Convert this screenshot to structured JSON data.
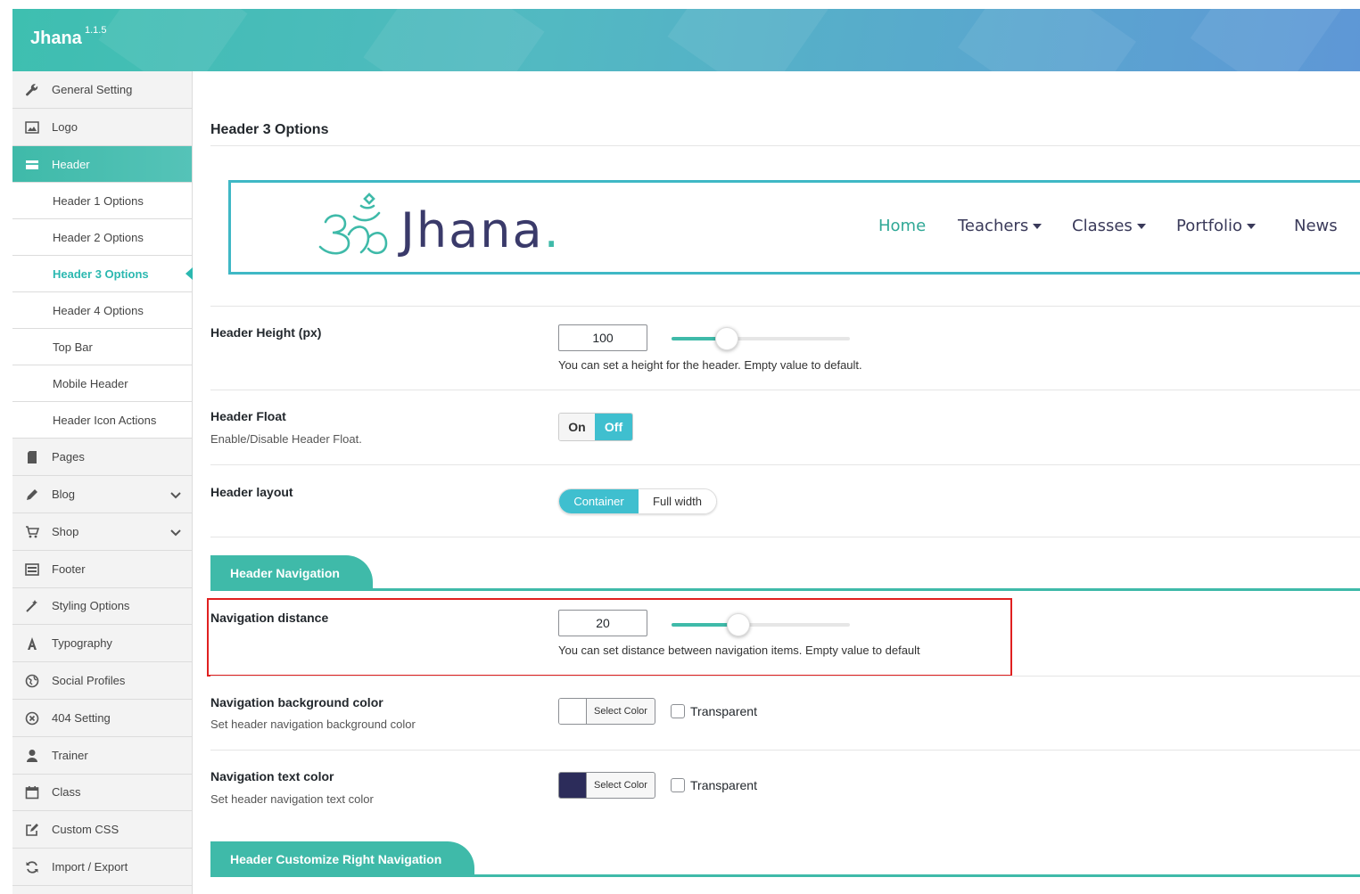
{
  "app": {
    "brand": "Jhana",
    "version": "1.1.5"
  },
  "colors": {
    "accent": "#3fbaa9",
    "toggle_active": "#3fbfcf",
    "highlight": "#e02020",
    "nav_text_color": "#2c2c5a"
  },
  "sidebar": {
    "items": [
      {
        "label": "General Setting",
        "icon": "wrench-icon"
      },
      {
        "label": "Logo",
        "icon": "image-icon"
      },
      {
        "label": "Header",
        "icon": "card-icon"
      },
      {
        "label": "Header 1 Options"
      },
      {
        "label": "Header 2 Options"
      },
      {
        "label": "Header 3 Options"
      },
      {
        "label": "Header 4 Options"
      },
      {
        "label": "Top Bar"
      },
      {
        "label": "Mobile Header"
      },
      {
        "label": "Header Icon Actions"
      },
      {
        "label": "Pages",
        "icon": "pages-icon"
      },
      {
        "label": "Blog",
        "icon": "pencil-icon"
      },
      {
        "label": "Shop",
        "icon": "cart-icon"
      },
      {
        "label": "Footer",
        "icon": "footer-icon"
      },
      {
        "label": "Styling Options",
        "icon": "wand-icon"
      },
      {
        "label": "Typography",
        "icon": "typography-icon"
      },
      {
        "label": "Social Profiles",
        "icon": "globe-icon"
      },
      {
        "label": "404 Setting",
        "icon": "circle-x-icon"
      },
      {
        "label": "Trainer",
        "icon": "user-icon"
      },
      {
        "label": "Class",
        "icon": "calendar-icon"
      },
      {
        "label": "Custom CSS",
        "icon": "edit-icon"
      },
      {
        "label": "Import / Export",
        "icon": "refresh-icon"
      }
    ]
  },
  "main": {
    "title": "Header 3 Options",
    "preview": {
      "logo_text": "Jhana",
      "logo_dot": ".",
      "nav": [
        "Home",
        "Teachers",
        "Classes",
        "Portfolio",
        "News"
      ]
    },
    "header_height": {
      "label": "Header Height (px)",
      "value": "100",
      "slider_fraction": 0.31,
      "help": "You can set a height for the header. Empty value to default."
    },
    "header_float": {
      "label": "Header Float",
      "desc": "Enable/Disable Header Float.",
      "on": "On",
      "off": "Off",
      "selected": "Off"
    },
    "header_layout": {
      "label": "Header layout",
      "options": [
        "Container",
        "Full width"
      ],
      "selected": "Container"
    },
    "section_nav": {
      "title": "Header Navigation"
    },
    "nav_distance": {
      "label": "Navigation distance",
      "value": "20",
      "slider_fraction": 0.375,
      "help": "You can set distance between navigation items. Empty value to default"
    },
    "nav_bg": {
      "label": "Navigation background color",
      "desc": "Set header navigation background color",
      "button": "Select Color",
      "swatch": "#ffffff",
      "transparent": "Transparent"
    },
    "nav_text": {
      "label": "Navigation text color",
      "desc": "Set header navigation text color",
      "button": "Select Color",
      "swatch": "#2c2c5a",
      "transparent": "Transparent"
    },
    "section_right": {
      "title": "Header Customize Right Navigation"
    }
  }
}
